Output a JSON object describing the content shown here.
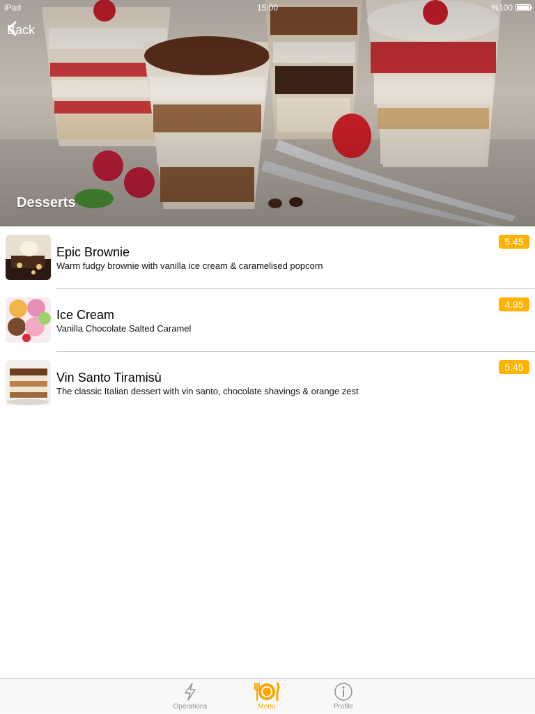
{
  "status_bar": {
    "device": "iPad",
    "time": "15:00",
    "battery": "%100"
  },
  "nav": {
    "back_label": "Back"
  },
  "hero": {
    "title": "Desserts"
  },
  "menu_items": [
    {
      "name": "Epic Brownie",
      "description": "Warm fudgy brownie with vanilla ice cream & caramelised popcorn",
      "price": "5.45"
    },
    {
      "name": "Ice Cream",
      "description": "Vanilla Chocolate Salted Caramel",
      "price": "4.95"
    },
    {
      "name": "Vin Santo Tiramisù",
      "description": "The classic Italian dessert with vin santo, chocolate shavings & orange zest",
      "price": "5.45"
    }
  ],
  "tab_bar": {
    "tabs": [
      {
        "label": "Operations",
        "icon": "lightning-icon",
        "active": false
      },
      {
        "label": "Menu",
        "icon": "plate-cutlery-icon",
        "active": true
      },
      {
        "label": "Profile",
        "icon": "info-icon",
        "active": false
      }
    ]
  },
  "colors": {
    "accent": "#ffa500",
    "price_badge": "#ffb300",
    "separator": "#c8c7cc"
  }
}
